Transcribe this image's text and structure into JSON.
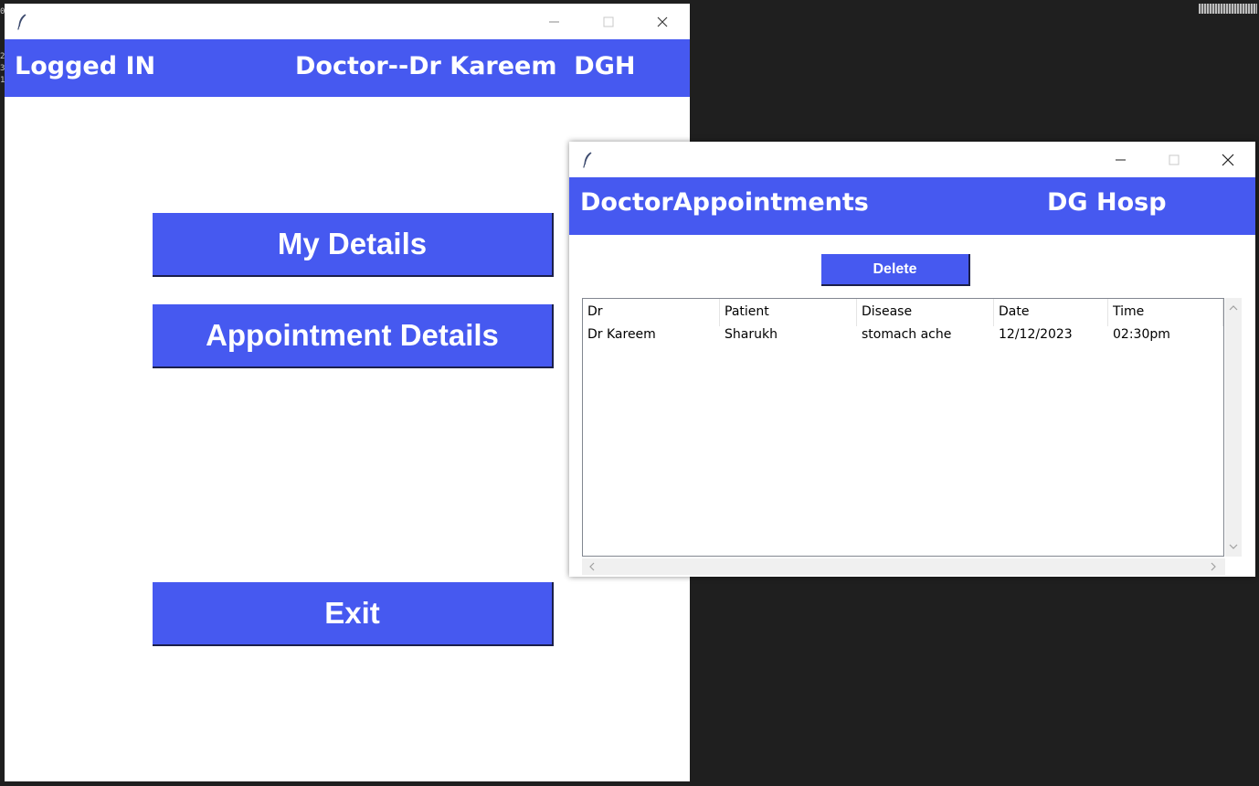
{
  "main_window": {
    "banner": {
      "left_text": "Logged IN",
      "right_text": "Doctor--Dr Kareem  DGH"
    },
    "buttons": {
      "my_details": "My Details",
      "appointment_details": "Appointment Details",
      "exit": "Exit"
    }
  },
  "appointments_window": {
    "banner": {
      "left_text": "DoctorAppointments",
      "right_text": "DG Hosp"
    },
    "delete_label": "Delete",
    "table": {
      "columns": [
        "Dr",
        "Patient",
        "Disease",
        "Date",
        "Time"
      ],
      "rows": [
        [
          "Dr Kareem",
          "Sharukh",
          "stomach ache",
          "12/12/2023",
          "02:30pm"
        ]
      ]
    }
  },
  "colors": {
    "accent": "#4659f0",
    "desktop": "#1f1f1f"
  },
  "icons": [
    "feather-icon",
    "minimize-icon",
    "maximize-icon",
    "close-icon",
    "chevron-up-icon",
    "chevron-down-icon",
    "chevron-left-icon",
    "chevron-right-icon"
  ]
}
